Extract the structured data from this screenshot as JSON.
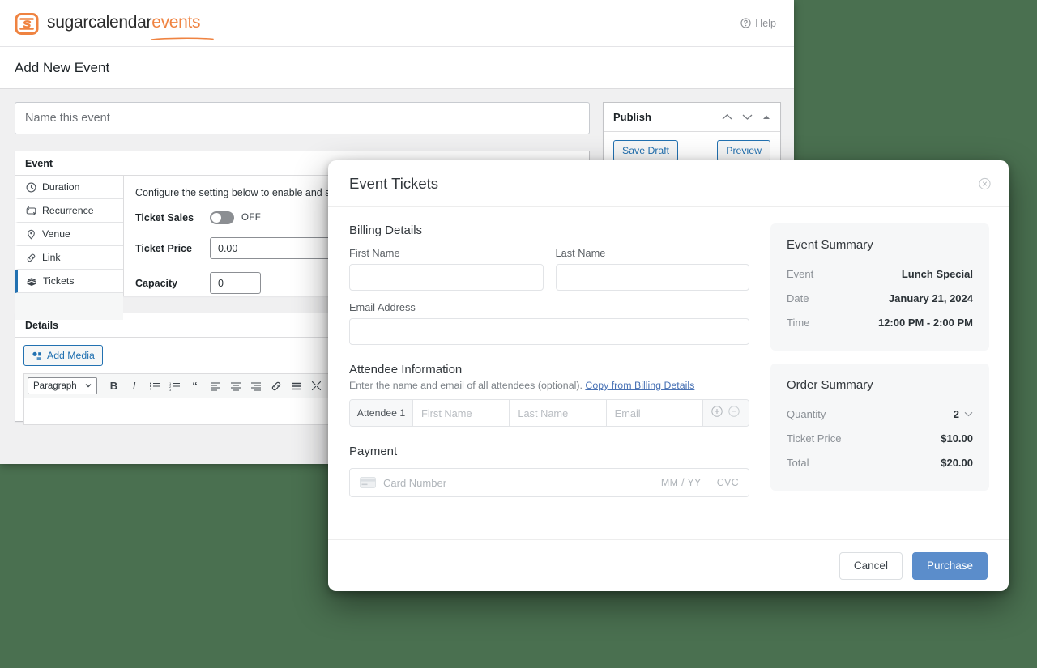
{
  "brand": {
    "logo_icon": "calendar-icon",
    "name_dark": "sugarcalendar",
    "name_accent": "events",
    "accent_color": "#ef8341"
  },
  "topbar": {
    "help_label": "Help",
    "help_icon": "question-circle-icon"
  },
  "page": {
    "title": "Add New Event",
    "title_input_placeholder": "Name this event",
    "title_input_value": ""
  },
  "event_panel": {
    "heading": "Event",
    "tabs": [
      {
        "label": "Duration",
        "icon": "clock-icon",
        "active": false
      },
      {
        "label": "Recurrence",
        "icon": "repeat-icon",
        "active": false
      },
      {
        "label": "Venue",
        "icon": "map-pin-icon",
        "active": false
      },
      {
        "label": "Link",
        "icon": "link-icon",
        "active": false
      },
      {
        "label": "Tickets",
        "icon": "tickets-icon",
        "active": true
      }
    ],
    "pane": {
      "note": "Configure the setting below to enable and sell t",
      "ticket_sales_label": "Ticket Sales",
      "ticket_sales_state": "OFF",
      "ticket_price_label": "Ticket Price",
      "ticket_price_value": "0.00",
      "capacity_label": "Capacity",
      "capacity_value": "0"
    }
  },
  "details_panel": {
    "heading": "Details",
    "add_media_label": "Add Media",
    "add_media_icon": "media-icon",
    "format_select": "Paragraph",
    "toolbar_icons": [
      "bold-icon",
      "italic-icon",
      "bullet-list-icon",
      "numbered-list-icon",
      "blockquote-icon",
      "align-left-icon",
      "align-center-icon",
      "align-right-icon",
      "link-icon",
      "read-more-icon",
      "fullscreen-icon",
      "toolbar-toggle-icon"
    ]
  },
  "publish_box": {
    "heading": "Publish",
    "header_icons": [
      "chevron-up-icon",
      "chevron-down-icon",
      "collapse-icon"
    ],
    "save_draft_label": "Save Draft",
    "preview_label": "Preview"
  },
  "modal": {
    "title": "Event Tickets",
    "close_icon": "close-circle-icon",
    "billing": {
      "heading": "Billing Details",
      "first_name_label": "First Name",
      "first_name_value": "",
      "last_name_label": "Last Name",
      "last_name_value": "",
      "email_label": "Email Address",
      "email_value": ""
    },
    "attendees": {
      "heading": "Attendee Information",
      "subtext": "Enter the name and email of all attendees (optional).",
      "copy_link_label": "Copy from Billing Details",
      "rows": [
        {
          "tag": "Attendee 1",
          "first_name_placeholder": "First Name",
          "last_name_placeholder": "Last Name",
          "email_placeholder": "Email",
          "add_icon": "plus-circle-icon",
          "remove_icon": "minus-circle-icon"
        }
      ]
    },
    "payment": {
      "heading": "Payment",
      "card_icon": "credit-card-icon",
      "card_number_placeholder": "Card Number",
      "expiry_placeholder": "MM / YY",
      "cvc_placeholder": "CVC"
    },
    "event_summary": {
      "heading": "Event Summary",
      "rows": [
        {
          "key": "Event",
          "value": "Lunch Special"
        },
        {
          "key": "Date",
          "value": "January 21, 2024"
        },
        {
          "key": "Time",
          "value": "12:00 PM - 2:00 PM"
        }
      ]
    },
    "order_summary": {
      "heading": "Order Summary",
      "quantity_label": "Quantity",
      "quantity_value": "2",
      "quantity_icon": "chevron-down-icon",
      "ticket_price_label": "Ticket Price",
      "ticket_price_value": "$10.00",
      "total_label": "Total",
      "total_value": "$20.00"
    },
    "footer": {
      "cancel_label": "Cancel",
      "purchase_label": "Purchase",
      "purchase_color": "#5b8dcb"
    }
  }
}
